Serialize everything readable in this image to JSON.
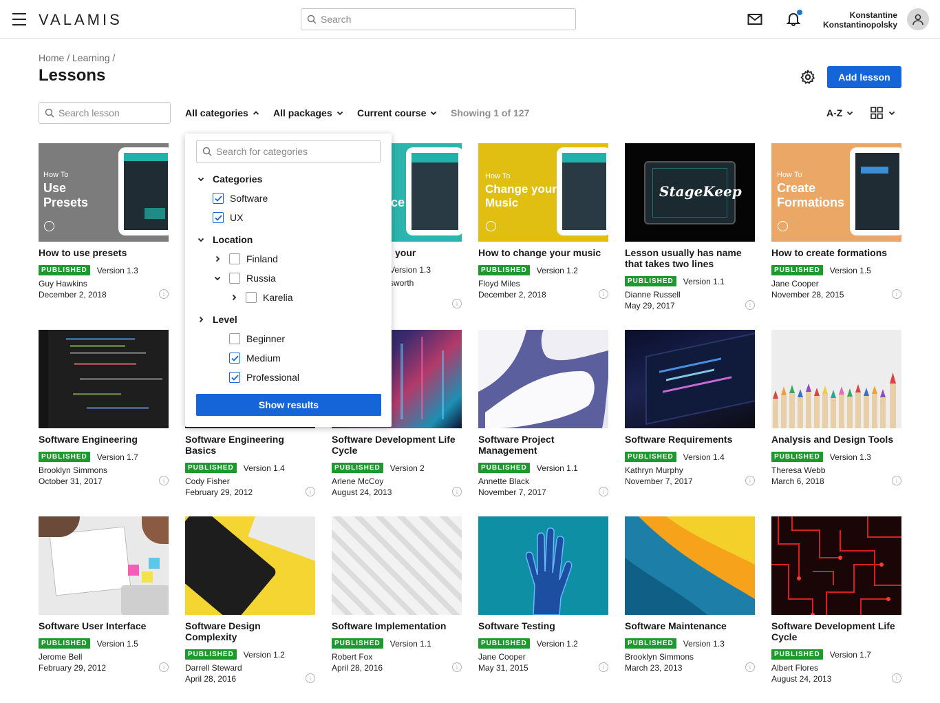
{
  "header": {
    "logo": "VALAMIS",
    "search_placeholder": "Search",
    "user_first": "Konstantine",
    "user_last": "Konstantinopolsky"
  },
  "breadcrumb": "Home / Learning /",
  "page_title": "Lessons",
  "add_lesson_label": "Add lesson",
  "search_lesson_placeholder": "Search lesson",
  "filters": {
    "categories": "All categories",
    "packages": "All packages",
    "course": "Current course",
    "showing": "Showing 1 of 127",
    "sort": "A-Z"
  },
  "dropdown": {
    "search_placeholder": "Search for categories",
    "categories_label": "Categories",
    "software": "Software",
    "ux": "UX",
    "location_label": "Location",
    "finland": "Finland",
    "russia": "Russia",
    "karelia": "Karelia",
    "level_label": "Level",
    "beginner": "Beginner",
    "medium": "Medium",
    "professional": "Professional",
    "show_results": "Show results"
  },
  "status_label": "PUBLISHED",
  "thumb_text": {
    "howto": "How To",
    "use": "Use",
    "presets": "Presets",
    "frag_ce": "ce",
    "change": "Change your",
    "music": "Music",
    "create": "Create",
    "formations": "Formations",
    "stagekeep": "StageKeep"
  },
  "cards": [
    {
      "title": "How to use presets",
      "version": "Version 1.3",
      "author": "Guy Hawkins",
      "date": "December 2, 2018"
    },
    {
      "title": "your",
      "version": "Version 1.3",
      "author": "sworth",
      "date": ""
    },
    {
      "title": "How to change your music",
      "version": "Version 1.2",
      "author": "Floyd Miles",
      "date": "December 2, 2018"
    },
    {
      "title": "Lesson usually has name that takes two lines",
      "version": "Version 1.1",
      "author": "Dianne Russell",
      "date": "May 29, 2017"
    },
    {
      "title": "How to create formations",
      "version": "Version 1.5",
      "author": "Jane Cooper",
      "date": "November 28, 2015"
    },
    {
      "title": "Software Engineering",
      "version": "Version 1.7",
      "author": "Brooklyn Simmons",
      "date": "October 31, 2017"
    },
    {
      "title": "Software Engineering Basics",
      "version": "Version 1.4",
      "author": "Cody Fisher",
      "date": "February 29, 2012"
    },
    {
      "title": "Software Development Life Cycle",
      "version": "Version 2",
      "author": "Arlene McCoy",
      "date": "August 24, 2013"
    },
    {
      "title": "Software Project Management",
      "version": "Version 1.1",
      "author": "Annette Black",
      "date": "November 7, 2017"
    },
    {
      "title": "Software Requirements",
      "version": "Version 1.4",
      "author": "Kathryn Murphy",
      "date": "November 7, 2017"
    },
    {
      "title": "Analysis and Design Tools",
      "version": "Version 1.3",
      "author": "Theresa Webb",
      "date": "March 6, 2018"
    },
    {
      "title": "Software User Interface",
      "version": "Version 1.5",
      "author": "Jerome Bell",
      "date": "February 29, 2012"
    },
    {
      "title": "Software Design Complexity",
      "version": "Version 1.2",
      "author": "Darrell Steward",
      "date": "April 28, 2016"
    },
    {
      "title": "Software Implementation",
      "version": "Version 1.1",
      "author": "Robert Fox",
      "date": "April 28, 2016"
    },
    {
      "title": "Software Testing",
      "version": "Version 1.2",
      "author": "Jane Cooper",
      "date": "May 31, 2015"
    },
    {
      "title": "Software Maintenance",
      "version": "Version 1.3",
      "author": "Brooklyn Simmons",
      "date": "March 23, 2013"
    },
    {
      "title": "Software Development Life Cycle",
      "version": "Version 1.7",
      "author": "Albert Flores",
      "date": "August 24, 2013"
    }
  ]
}
